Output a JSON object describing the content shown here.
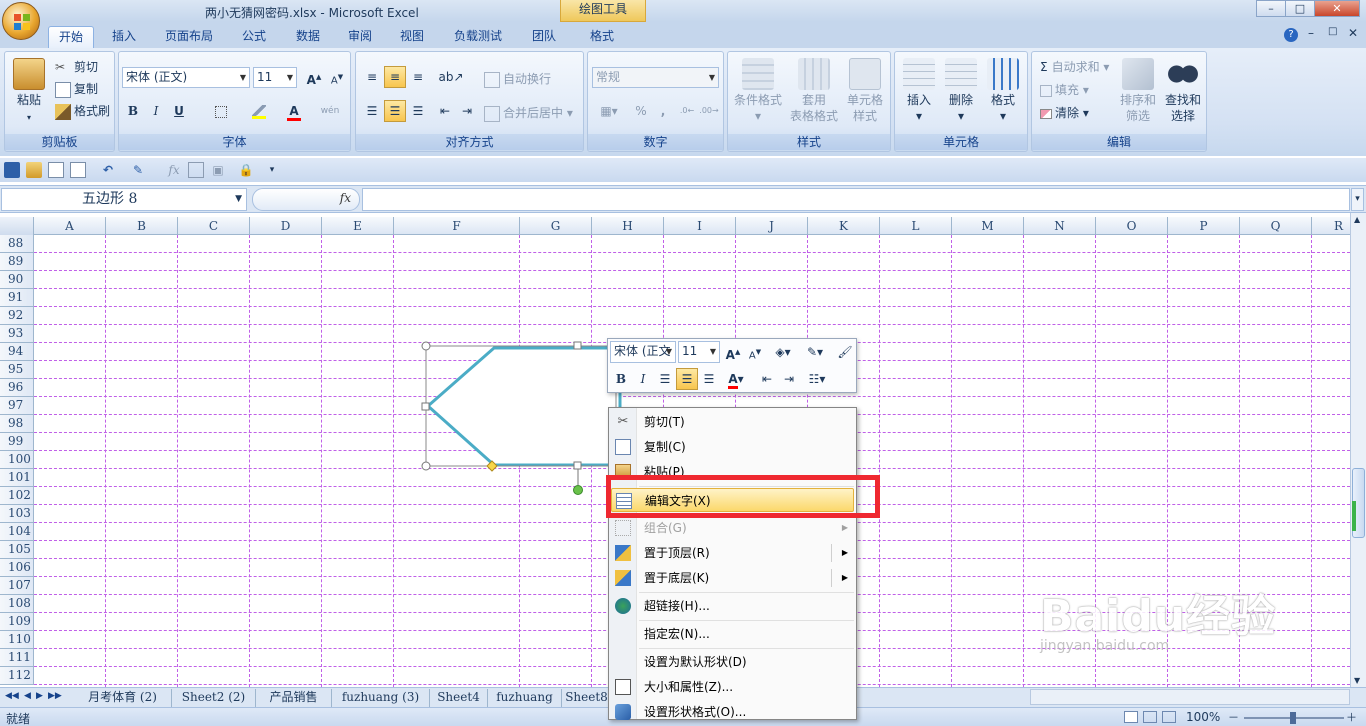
{
  "window": {
    "title": "两小无猜网密码.xlsx - Microsoft Excel",
    "context_tool": "绘图工具",
    "controls": [
      "–",
      "□",
      "✕"
    ],
    "ribbon_controls": [
      "?",
      "–",
      "□",
      "✕"
    ]
  },
  "tabs": [
    {
      "label": "开始",
      "active": true
    },
    {
      "label": "插入"
    },
    {
      "label": "页面布局"
    },
    {
      "label": "公式"
    },
    {
      "label": "数据"
    },
    {
      "label": "审阅"
    },
    {
      "label": "视图"
    },
    {
      "label": "负载测试"
    },
    {
      "label": "团队"
    },
    {
      "label": "格式"
    }
  ],
  "ribbon": {
    "clipboard": {
      "label": "剪贴板",
      "paste": "粘贴",
      "cut": "剪切",
      "copy": "复制",
      "format_painter": "格式刷"
    },
    "font": {
      "label": "字体",
      "name": "宋体 (正文)",
      "size": "11",
      "grow": "A",
      "shrink": "A",
      "bold": "B",
      "italic": "I",
      "underline": "U",
      "color_letter": "A",
      "phonetic": "wén"
    },
    "alignment": {
      "label": "对齐方式",
      "wrap": "自动换行",
      "merge": "合并后居中"
    },
    "number": {
      "label": "数字",
      "format": "常规",
      "percent": "%",
      "comma": ","
    },
    "styles": {
      "label": "样式",
      "conditional": "条件格式",
      "table": "套用\n表格格式",
      "cell": "单元格\n样式"
    },
    "cells": {
      "label": "单元格",
      "insert": "插入",
      "delete": "删除",
      "format": "格式"
    },
    "editing": {
      "label": "编辑",
      "autosum": "自动求和",
      "fill": "填充",
      "clear": "清除",
      "sort": "排序和\n筛选",
      "find": "查找和\n选择"
    }
  },
  "formula_bar": {
    "name_box": "五边形 8",
    "fx": "fx",
    "value": ""
  },
  "columns": [
    "A",
    "B",
    "C",
    "D",
    "E",
    "F",
    "G",
    "H",
    "I",
    "J",
    "K",
    "L",
    "M",
    "N",
    "O",
    "P",
    "Q",
    "R"
  ],
  "rows": [
    "88",
    "89",
    "90",
    "91",
    "92",
    "93",
    "94",
    "95",
    "96",
    "97",
    "98",
    "99",
    "100",
    "101",
    "102",
    "103",
    "104",
    "105",
    "106",
    "107",
    "108",
    "109",
    "110",
    "111",
    "112"
  ],
  "mini_toolbar": {
    "font": "宋体 (正文",
    "size": "11",
    "bold": "B",
    "italic": "I",
    "color_letter": "A"
  },
  "context_menu": [
    {
      "label": "剪切(T)"
    },
    {
      "label": "复制(C)"
    },
    {
      "label": "粘贴(P)"
    },
    {
      "sep": true
    },
    {
      "label": "编辑文字(X)",
      "highlight": true
    },
    {
      "sep": true
    },
    {
      "label": "组合(G)",
      "disabled": true,
      "submenu": true
    },
    {
      "label": "置于顶层(R)",
      "submenu": true
    },
    {
      "label": "置于底层(K)",
      "submenu": true
    },
    {
      "sep": true
    },
    {
      "label": "超链接(H)..."
    },
    {
      "sep": true
    },
    {
      "label": "指定宏(N)..."
    },
    {
      "sep": true
    },
    {
      "label": "设置为默认形状(D)"
    },
    {
      "label": "大小和属性(Z)..."
    },
    {
      "label": "设置形状格式(O)..."
    }
  ],
  "sheet_tabs": [
    "月考体育 (2)",
    "Sheet2 (2)",
    "产品销售",
    "fuzhuang (3)",
    "Sheet4",
    "fuzhuang",
    "Sheet8"
  ],
  "status": {
    "ready": "就绪",
    "zoom": "100%",
    "zoom_minus": "－",
    "zoom_plus": "＋"
  },
  "watermark": {
    "logo": "Baidu经验",
    "url": "jingyan.baidu.com"
  },
  "colors": {
    "selection_box": "#ef2830",
    "shape_outline": "#4bacc6",
    "gridline": "#c060e8",
    "menu_highlight": "#fbd86b"
  }
}
